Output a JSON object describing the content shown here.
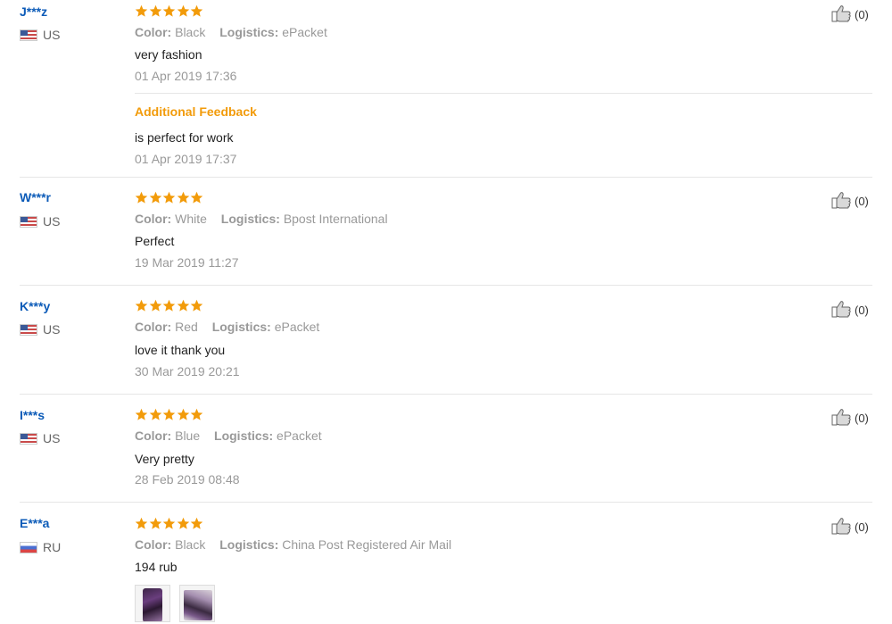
{
  "colors": {
    "username": "#0c5bb8",
    "star": "#f29b0a",
    "additional_feedback": "#f29b0a",
    "muted": "#999999"
  },
  "reviews": [
    {
      "user": "J***z",
      "country": "US",
      "flag": "us-flag",
      "rating": 5,
      "color_label": "Color:",
      "color": "Black",
      "logistics_label": "Logistics:",
      "logistics": "ePacket",
      "text": "very fashion",
      "date": "01 Apr 2019 17:36",
      "helpful": "(0)",
      "additional": {
        "title": "Additional Feedback",
        "text": "is perfect for work",
        "date": "01 Apr 2019 17:37"
      }
    },
    {
      "user": "W***r",
      "country": "US",
      "flag": "us-flag",
      "rating": 5,
      "color_label": "Color:",
      "color": "White",
      "logistics_label": "Logistics:",
      "logistics": "Bpost International",
      "text": "Perfect",
      "date": "19 Mar 2019 11:27",
      "helpful": "(0)"
    },
    {
      "user": "K***y",
      "country": "US",
      "flag": "us-flag",
      "rating": 5,
      "color_label": "Color:",
      "color": "Red",
      "logistics_label": "Logistics:",
      "logistics": "ePacket",
      "text": "love it thank you",
      "date": "30 Mar 2019 20:21",
      "helpful": "(0)"
    },
    {
      "user": "I***s",
      "country": "US",
      "flag": "us-flag",
      "rating": 5,
      "color_label": "Color:",
      "color": "Blue",
      "logistics_label": "Logistics:",
      "logistics": "ePacket",
      "text": "Very pretty",
      "date": "28 Feb 2019 08:48",
      "helpful": "(0)"
    },
    {
      "user": "E***a",
      "country": "RU",
      "flag": "ru-flag",
      "rating": 5,
      "color_label": "Color:",
      "color": "Black",
      "logistics_label": "Logistics:",
      "logistics": "China Post Registered Air Mail",
      "text": "194 rub",
      "helpful": "(0)",
      "photos": [
        "photo-thumbnail",
        "photo-thumbnail"
      ]
    }
  ]
}
